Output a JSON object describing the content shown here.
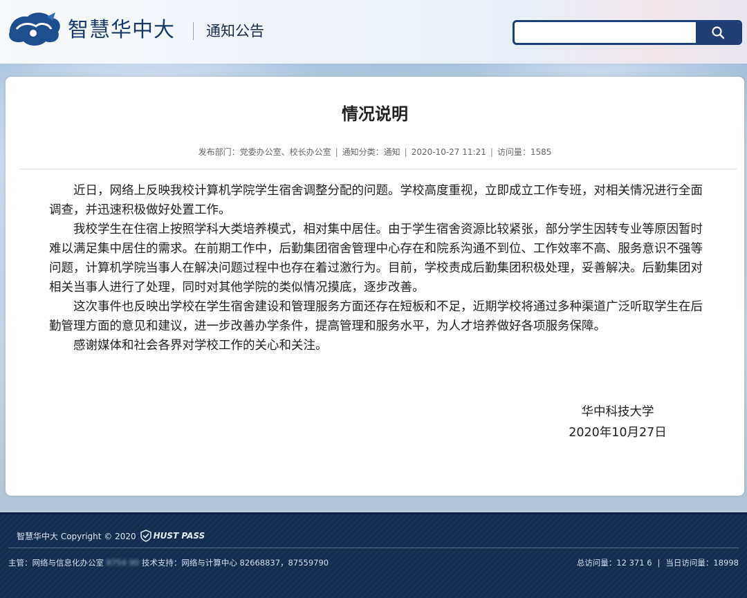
{
  "header": {
    "site_name": "智慧华中大",
    "section_title": "通知公告",
    "search": {
      "placeholder": "",
      "button_icon": "search-icon"
    }
  },
  "article": {
    "title": "情况说明",
    "meta": {
      "department": "发布部门：党委办公室、校长办公室",
      "category": "通知分类：通知",
      "datetime": "2020-10-27 11:21",
      "views": "访问量：1585"
    },
    "paragraphs": [
      "近日，网络上反映我校计算机学院学生宿舍调整分配的问题。学校高度重视，立即成立工作专班，对相关情况进行全面调查，并迅速积极做好处置工作。",
      "我校学生在住宿上按照学科大类培养模式，相对集中居住。由于学生宿舍资源比较紧张，部分学生因转专业等原因暂时难以满足集中居住的需求。在前期工作中，后勤集团宿舍管理中心存在和院系沟通不到位、工作效率不高、服务意识不强等问题，计算机学院当事人在解决问题过程中也存在着过激行为。目前，学校责成后勤集团积极处理，妥善解决。后勤集团对相关当事人进行了处理，同时对其他学院的类似情况摸底，逐步改善。",
      "这次事件也反映出学校在学生宿舍建设和管理服务方面还存在短板和不足，近期学校将通过多种渠道广泛听取学生在后勤管理方面的意见和建议，进一步改善办学条件，提高管理和服务水平，为人才培养做好各项服务保障。",
      "感谢媒体和社会各界对学校工作的关心和关注。"
    ],
    "signature": {
      "org": "华中科技大学",
      "date": "2020年10月27日"
    }
  },
  "footer": {
    "copyright": "智慧华中大 Copyright © 2020",
    "pass_label": "HUST PASS",
    "host_label": "主管：网络与信息化办公室",
    "host_phone": "8754  90",
    "support": "技术支持：网络与计算中心 82668837，87559790",
    "total_visits": "总访问量：12  371  6",
    "today_visits": "当日访问量：18998"
  },
  "colors": {
    "brand_navy": "#1d3f74",
    "footer_bg": "#142b52"
  }
}
